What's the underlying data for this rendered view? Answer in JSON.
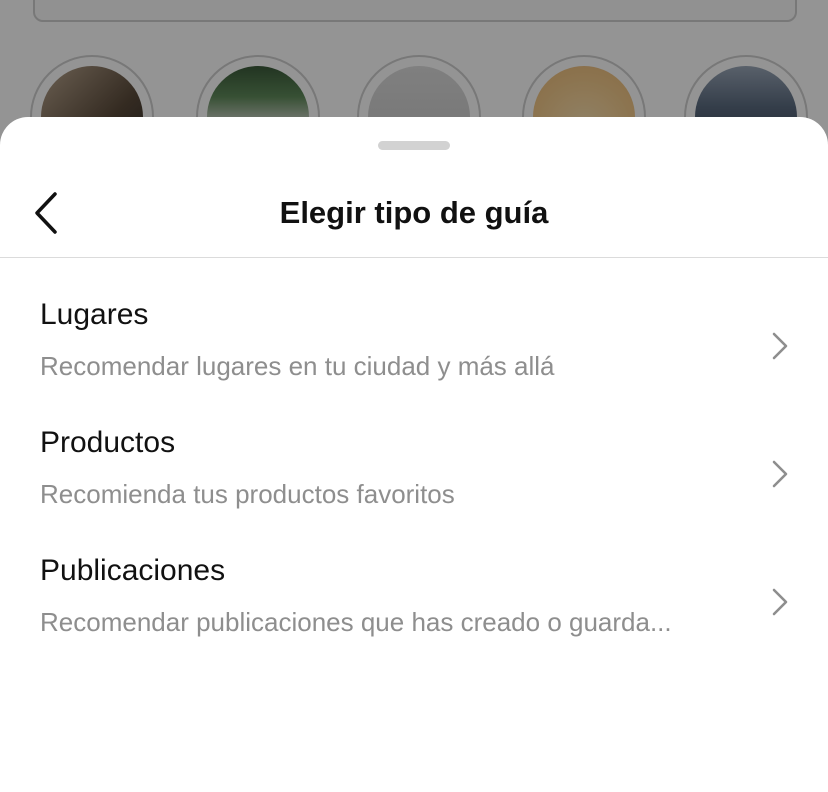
{
  "sheet": {
    "title": "Elegir tipo de guía",
    "back_icon": "chevron-left-icon"
  },
  "options": [
    {
      "label": "Lugares",
      "description": "Recomendar lugares en tu ciudad y más allá",
      "icon": "chevron-right-icon"
    },
    {
      "label": "Productos",
      "description": "Recomienda tus productos favoritos",
      "icon": "chevron-right-icon"
    },
    {
      "label": "Publicaciones",
      "description": "Recomendar publicaciones que has creado o guarda...",
      "icon": "chevron-right-icon"
    }
  ],
  "colors": {
    "title": "#111111",
    "description": "#8e8e8e",
    "divider": "#dbdbdb",
    "chevron": "#8e8e8e"
  }
}
